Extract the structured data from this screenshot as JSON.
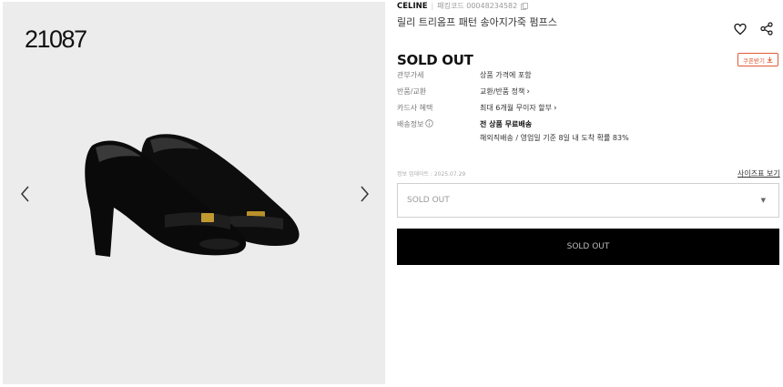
{
  "gallery": {
    "watermark": "21087"
  },
  "product": {
    "brand": "CELINE",
    "code_label": "패킹코드 00048234582",
    "title": "릴리 트리옴프 패턴 송아지가죽 펌프스",
    "status": "SOLD OUT",
    "coupon_label": "쿠폰받기"
  },
  "details": [
    {
      "label": "관부가세",
      "value": "상품 가격에 포함"
    },
    {
      "label": "반품/교환",
      "value": "교환/반품 정책"
    },
    {
      "label": "카드사 혜택",
      "value": "최대 6개월 무이자 할부"
    },
    {
      "label": "배송정보",
      "value": "전 상품 무료배송",
      "sub": "해외직배송 / 영업일 기준 8일 내 도착 확률 83%"
    }
  ],
  "updated_label": "정보 업데이트 : 2025.07.29",
  "size_guide_label": "사이즈표 보기",
  "option_select": {
    "value": "SOLD OUT"
  },
  "buy_button": {
    "label": "SOLD OUT"
  },
  "colors": {
    "accent": "#e05a34",
    "button_bg": "#000000",
    "gallery_bg": "#ececec"
  }
}
